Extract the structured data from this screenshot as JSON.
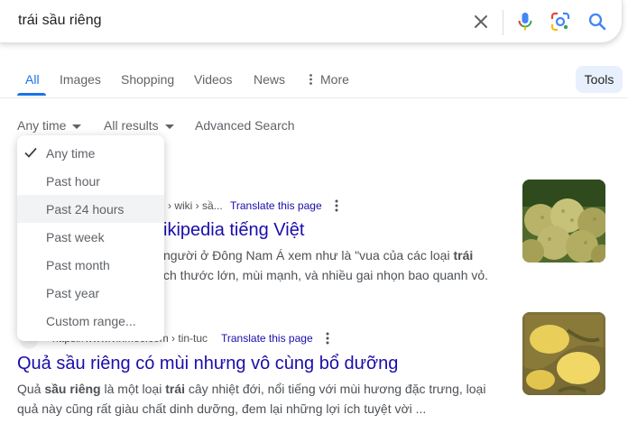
{
  "search": {
    "query": "trái sầu riêng"
  },
  "tabs": [
    {
      "label": "All"
    },
    {
      "label": "Images"
    },
    {
      "label": "Shopping"
    },
    {
      "label": "Videos"
    },
    {
      "label": "News"
    },
    {
      "label": "More"
    }
  ],
  "tools_label": "Tools",
  "filters": {
    "time_label": "Any time",
    "results_label": "All results",
    "advanced_label": "Advanced Search"
  },
  "time_menu": {
    "selected": "Any time",
    "highlighted": "Past 24 hours",
    "items": [
      {
        "label": "Any time"
      },
      {
        "label": "Past hour"
      },
      {
        "label": "Past 24 hours"
      },
      {
        "label": "Past week"
      },
      {
        "label": "Past month"
      },
      {
        "label": "Past year"
      },
      {
        "label": "Custom range..."
      }
    ]
  },
  "results": [
    {
      "cite": "› wiki › sầ...",
      "translate": "Translate this page",
      "title": "ikipedia tiếng Việt",
      "snippet_line1_pre": "người ở Đông Nam Á xem như là \"vua của các loại ",
      "snippet_line1_bold": "trái",
      "snippet_line2": "ch thước lớn, mùi mạnh, và nhiều gai nhọn bao quanh vỏ.",
      "thumbnail": "durian-pile-image"
    },
    {
      "cite": "https://www.vinmec.com › tin-tuc",
      "translate": "Translate this page",
      "title": "Quả sầu riêng có mùi nhưng vô cùng bổ dưỡng",
      "snippet_line1_a": "Quả ",
      "snippet_line1_b1": "sầu riêng",
      "snippet_line1_c": " là một loại ",
      "snippet_line1_b2": "trái",
      "snippet_line1_d": " cây nhiệt đới, nổi tiếng với mùi hương đặc trưng, loại",
      "snippet_line2": "quả này cũng rất giàu chất dinh dưỡng, đem lại những lợi ích tuyệt vời ...",
      "thumbnail": "durian-opened-image"
    }
  ],
  "colors": {
    "accent": "#1a73e8",
    "link": "#1a0dab",
    "text_secondary": "#4d5156"
  }
}
